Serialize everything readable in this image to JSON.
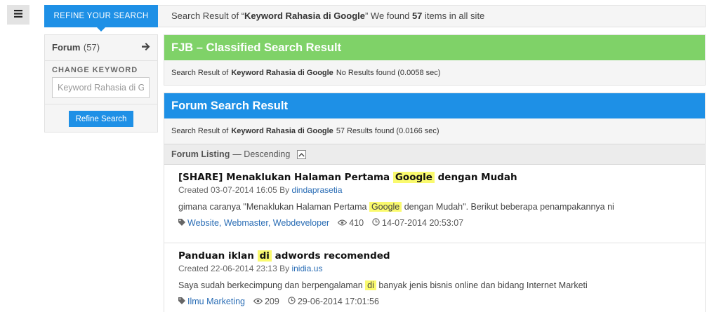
{
  "header": {
    "tab_label": "REFINE YOUR SEARCH",
    "summary_prefix": "Search Result of “",
    "keyword": "Keyword Rahasia di Google",
    "summary_mid": "” We found ",
    "count": "57",
    "summary_suffix": " items in all site"
  },
  "sidebar": {
    "forum_label": "Forum",
    "forum_count": "(57)",
    "change_keyword_label": "CHANGE KEYWORD",
    "keyword_value": "Keyword Rahasia di Google",
    "refine_button": "Refine Search"
  },
  "fjb": {
    "title": "FJB – Classified Search Result",
    "sub_prefix": "Search Result of",
    "keyword": "Keyword Rahasia di Google",
    "sub_suffix": " No Results found (0.0058 sec)"
  },
  "forum": {
    "title": "Forum Search Result",
    "sub_prefix": "Search Result of",
    "keyword": "Keyword Rahasia di Google",
    "sub_suffix": "57 Results found (0.0166 sec)",
    "listing_label": "Forum Listing",
    "listing_dir": "— Descending"
  },
  "results": [
    {
      "title_pre": "[SHARE] Menaklukan Halaman Pertama ",
      "title_hl": "Google",
      "title_post": " dengan Mudah",
      "created": "Created 03-07-2014 16:05 By ",
      "author": "dindaprasetia",
      "snippet_pre": "gimana caranya \"Menaklukan Halaman Pertama ",
      "snippet_hl": "Google",
      "snippet_post": " dengan Mudah\". Berikut beberapa penampakannya ni",
      "tags": "Website, Webmaster, Webdeveloper",
      "views": "410",
      "last": "14-07-2014 20:53:07"
    },
    {
      "title_pre": "Panduan iklan ",
      "title_hl": "di",
      "title_post": " adwords recomended",
      "created": "Created 22-06-2014 23:13 By ",
      "author": "inidia.us",
      "snippet_pre": "Saya sudah berkecimpung dan berpengalaman ",
      "snippet_hl": "di",
      "snippet_post": " banyak jenis bisnis online dan bidang Internet Marketi",
      "tags": "Ilmu Marketing",
      "views": "209",
      "last": "29-06-2014 17:01:56"
    }
  ],
  "colors": {
    "accent_blue": "#1e90e6",
    "fjb_green": "#7fd268",
    "highlight": "#fafa6e",
    "link": "#2a6db5"
  },
  "icons": [
    "menu-icon",
    "arrow-right-icon",
    "chevron-up-icon",
    "tag-icon",
    "eye-icon",
    "clock-icon"
  ]
}
